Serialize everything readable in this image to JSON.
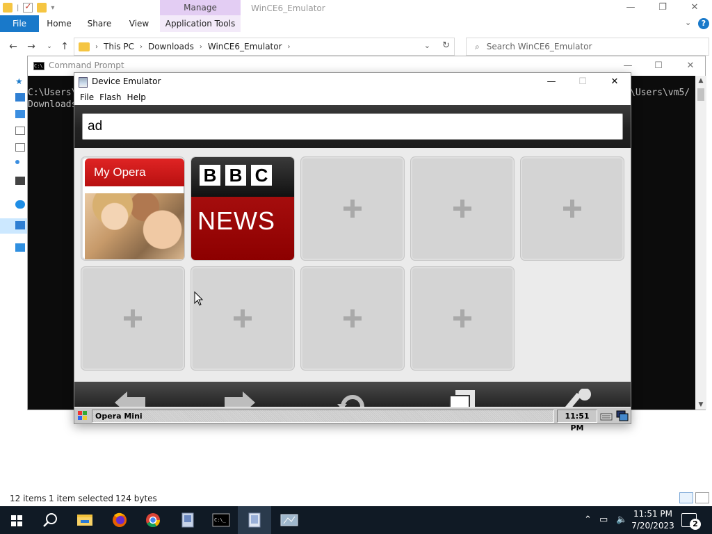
{
  "explorer": {
    "ribbon": {
      "manage_label": "Manage",
      "window_title": "WinCE6_Emulator",
      "tabs": {
        "file": "File",
        "home": "Home",
        "share": "Share",
        "view": "View",
        "app_tools": "Application Tools"
      },
      "help": "?"
    },
    "address": {
      "crumbs": [
        "This PC",
        "Downloads",
        "WinCE6_Emulator"
      ],
      "search_placeholder": "Search WinCE6_Emulator"
    },
    "status": {
      "items": "12 items",
      "selected": "1 item selected",
      "size": "124 bytes"
    }
  },
  "cmd": {
    "title": "Command Prompt",
    "lines": [
      "C:\\Users\\",
      "Downloads",
      "\\Users\\vm5/"
    ]
  },
  "emulator": {
    "title": "Device Emulator",
    "menu": {
      "file": "File",
      "flash": "Flash",
      "help": "Help"
    },
    "opera": {
      "address_value": "ad",
      "speed_dial": {
        "myopera_label": "My Opera",
        "bbc_letters": [
          "B",
          "B",
          "C"
        ],
        "bbc_news": "NEWS"
      }
    },
    "taskbar": {
      "task": "Opera Mini",
      "clock": "11:51 PM"
    }
  },
  "taskbar": {
    "time": "11:51 PM",
    "date": "7/20/2023",
    "notification_count": "2"
  },
  "colors": {
    "file_tab": "#1979ca",
    "manage_tab": "#e3cdf3",
    "opera_red": "#c41414",
    "bbc_red": "#a50d0d",
    "taskbar": "#101a25"
  }
}
